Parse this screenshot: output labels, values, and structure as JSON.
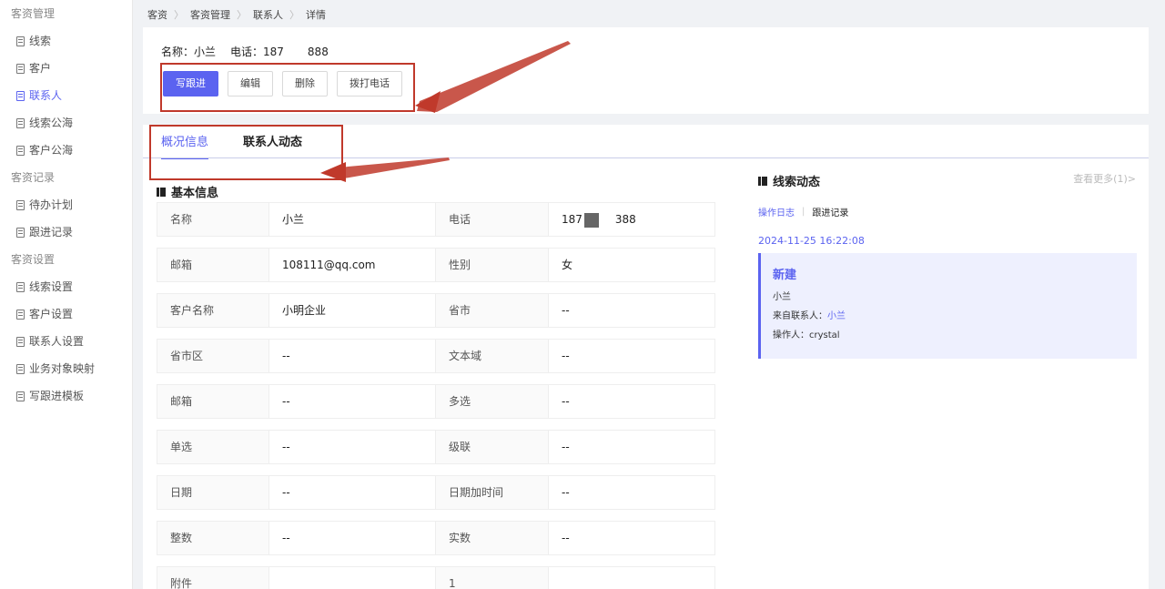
{
  "sidebar": {
    "groups": [
      {
        "label": "客资管理",
        "items": [
          "线索",
          "客户",
          "联系人",
          "线索公海",
          "客户公海"
        ]
      },
      {
        "label": "客资记录",
        "items": [
          "待办计划",
          "跟进记录"
        ]
      },
      {
        "label": "客资设置",
        "items": [
          "线索设置",
          "客户设置",
          "联系人设置",
          "业务对象映射",
          "写跟进模板"
        ]
      }
    ],
    "active": "联系人"
  },
  "breadcrumb": [
    "客资",
    "客资管理",
    "联系人",
    "详情"
  ],
  "header": {
    "name_label": "名称：小兰",
    "phone_label": "电话：187",
    "phone_tail": "888",
    "buttons": {
      "follow": "写跟进",
      "edit": "编辑",
      "delete": "删除",
      "call": "拨打电话"
    }
  },
  "tabs": [
    "概况信息",
    "联系人动态"
  ],
  "basic_info": {
    "title": "基本信息",
    "rows": [
      [
        "名称",
        "小兰",
        "电话",
        "187",
        "388"
      ],
      [
        "邮箱",
        "108111@qq.com",
        "性别",
        "女"
      ],
      [
        "客户名称",
        "小明企业",
        "省市",
        "--"
      ],
      [
        "省市区",
        "--",
        "文本域",
        "--"
      ],
      [
        "邮箱",
        "--",
        "多选",
        "--"
      ],
      [
        "单选",
        "--",
        "级联",
        "--"
      ],
      [
        "日期",
        "--",
        "日期加时间",
        "--"
      ],
      [
        "整数",
        "--",
        "实数",
        "--"
      ],
      [
        "附件",
        "",
        "1",
        ""
      ]
    ]
  },
  "dynamics": {
    "title": "线索动态",
    "more": "查看更多(1)>",
    "log_tabs": [
      "操作日志",
      "跟进记录"
    ],
    "time": "2024-11-25 16:22:08",
    "card": {
      "title": "新建",
      "line1": "小兰",
      "from_label": "来自联系人：",
      "from_value": "小兰",
      "operator": "操作人：crystal"
    }
  },
  "colors": {
    "accent": "#5b63f0",
    "annotation": "#c0392b"
  }
}
